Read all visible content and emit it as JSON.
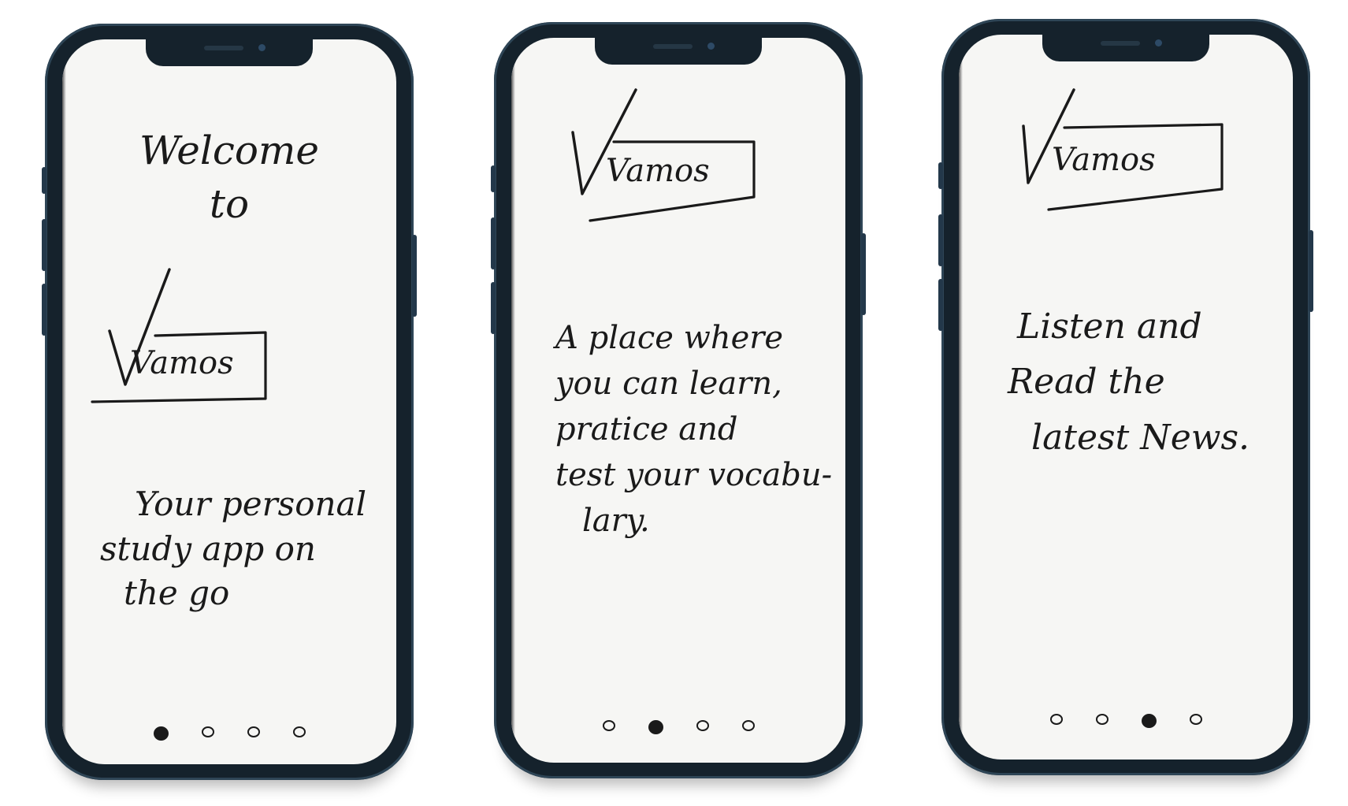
{
  "colors": {
    "frame": "#15222c",
    "screen": "#f6f6f4",
    "ink": "#1a1a1a"
  },
  "screens": [
    {
      "welcome_line1": "Welcome",
      "welcome_line2": "to",
      "logo_word": "Vamos",
      "tagline_line1": "Your personal",
      "tagline_line2": "study app on",
      "tagline_line3": "the go",
      "active_dot": 1,
      "dot_count": 4
    },
    {
      "logo_word": "Vamos",
      "body_line1": "A place where",
      "body_line2": "you can learn,",
      "body_line3": "pratice and",
      "body_line4": "test your vocabu-",
      "body_line5": "lary.",
      "active_dot": 2,
      "dot_count": 4
    },
    {
      "logo_word": "Vamos",
      "body_line1": "Listen and",
      "body_line2": "Read the",
      "body_line3": "latest News.",
      "active_dot": 3,
      "dot_count": 4
    }
  ]
}
